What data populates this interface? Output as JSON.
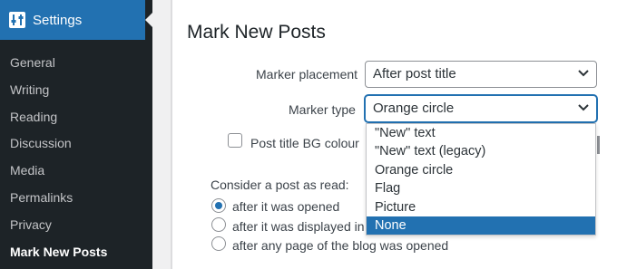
{
  "sidebar": {
    "header_label": "Settings",
    "header_icon": "settings-sliders-icon",
    "items": [
      {
        "label": "General"
      },
      {
        "label": "Writing"
      },
      {
        "label": "Reading"
      },
      {
        "label": "Discussion"
      },
      {
        "label": "Media"
      },
      {
        "label": "Permalinks"
      },
      {
        "label": "Privacy"
      },
      {
        "label": "Mark New Posts"
      }
    ]
  },
  "page": {
    "title": "Mark New Posts"
  },
  "form": {
    "marker_placement_label": "Marker placement",
    "marker_placement_value": "After post title",
    "marker_type_label": "Marker type",
    "marker_type_value": "Orange circle",
    "post_title_bg_label": "Post title BG colour",
    "consider_read_label": "Consider a post as read:",
    "radio_options": [
      {
        "label": "after it was opened"
      },
      {
        "label": "after it was displayed in"
      },
      {
        "label": "after any page of the blog was opened"
      }
    ],
    "dropdown_options": [
      {
        "label": "\"New\" text"
      },
      {
        "label": "\"New\" text (legacy)"
      },
      {
        "label": "Orange circle"
      },
      {
        "label": "Flag"
      },
      {
        "label": "Picture"
      },
      {
        "label": "None"
      }
    ]
  },
  "colors": {
    "accent": "#2271b1",
    "sidebar_bg": "#1d2327"
  }
}
